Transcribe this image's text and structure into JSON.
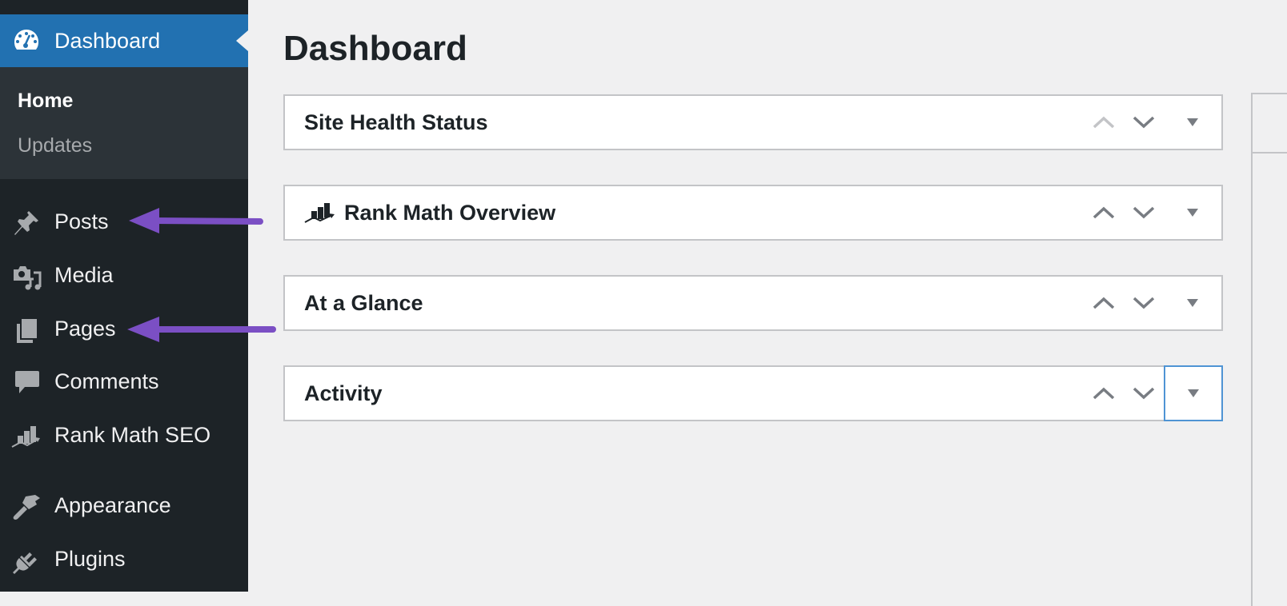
{
  "sidebar": {
    "current": {
      "label": "Dashboard",
      "icon": "dashboard-gauge-icon"
    },
    "submenu": [
      {
        "label": "Home",
        "active": true
      },
      {
        "label": "Updates",
        "active": false
      }
    ],
    "items": [
      {
        "label": "Posts",
        "icon": "pushpin-icon"
      },
      {
        "label": "Media",
        "icon": "media-icon"
      },
      {
        "label": "Pages",
        "icon": "pages-icon"
      },
      {
        "label": "Comments",
        "icon": "comment-bubble-icon"
      },
      {
        "label": "Rank Math SEO",
        "icon": "rank-math-icon"
      },
      {
        "label": "Appearance",
        "icon": "paintbrush-icon"
      },
      {
        "label": "Plugins",
        "icon": "plug-icon"
      }
    ]
  },
  "main": {
    "title": "Dashboard",
    "widgets": [
      {
        "title": "Site Health Status",
        "icon": null,
        "up_disabled": true,
        "toggle_focused": false
      },
      {
        "title": "Rank Math Overview",
        "icon": "rank-math-icon",
        "up_disabled": false,
        "toggle_focused": false
      },
      {
        "title": "At a Glance",
        "icon": null,
        "up_disabled": false,
        "toggle_focused": false
      },
      {
        "title": "Activity",
        "icon": null,
        "up_disabled": false,
        "toggle_focused": true
      }
    ]
  },
  "annotations": {
    "arrow_color": "#7b4fc4",
    "arrows": [
      {
        "points_to": "Posts"
      },
      {
        "points_to": "Pages"
      }
    ]
  },
  "colors": {
    "sidebar_bg": "#1d2327",
    "submenu_bg": "#2c3338",
    "accent": "#2271b1",
    "page_bg": "#f0f0f1"
  }
}
